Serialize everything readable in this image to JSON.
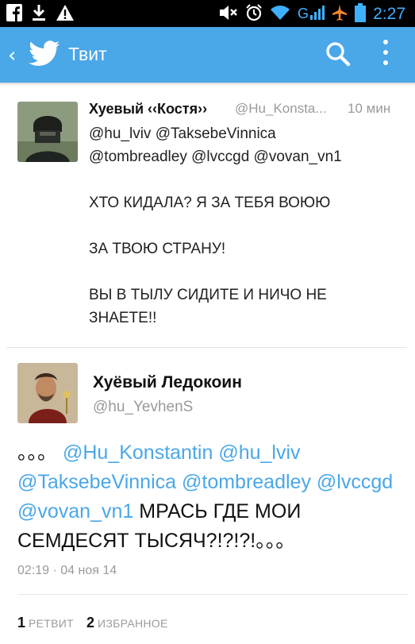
{
  "status_bar": {
    "time": "2:27",
    "icons": [
      "facebook-icon",
      "download-icon",
      "warning-icon",
      "mute-icon",
      "alarm-icon",
      "wifi-icon",
      "signal-icon",
      "airplane-icon",
      "battery-icon"
    ],
    "network_label": "G"
  },
  "action_bar": {
    "back_glyph": "‹",
    "title": "Твит",
    "icons": [
      "twitter-bird-icon",
      "search-icon",
      "overflow-menu-icon"
    ],
    "color": "#4aa7e8"
  },
  "tweet_context": {
    "author_name": "Хуевый ‹‹Костя››",
    "author_handle": "@Hu_Konsta...",
    "time_ago": "10 мин",
    "lines": [
      "@hu_lviv @TaksebeVinnica",
      "@tombreadley @lvccgd @vovan_vn1",
      "",
      "ХТО КИДАЛА? Я ЗА ТЕБЯ ВОЮЮ",
      "",
      "ЗА ТВОЮ СТРАНУ!",
      "",
      "ВЫ В ТЫЛУ СИДИТЕ И НИЧО НЕ",
      "ЗНАЕТЕ!!"
    ]
  },
  "tweet_main": {
    "author_name": "Хуёвый Ледокоин",
    "author_handle": "@hu_YevhenS",
    "text_prefix": "。。。",
    "mentions": [
      "@Hu_Konstantin",
      "@hu_lviv",
      "@TaksebeVinnica",
      "@tombreadley",
      "@lvccgd",
      "@vovan_vn1"
    ],
    "text_body": "МРАСЬ ГДЕ МОИ СЕМДЕСЯТ ТЫСЯЧ?!?!?!",
    "text_suffix": "。。。",
    "timestamp": "02:19 · 04 ноя 14",
    "retweets_count": "1",
    "retweets_label": "РЕТВИТ",
    "favorites_count": "2",
    "favorites_label": "ИЗБРАННОЕ",
    "link_color": "#4aa7e8"
  }
}
